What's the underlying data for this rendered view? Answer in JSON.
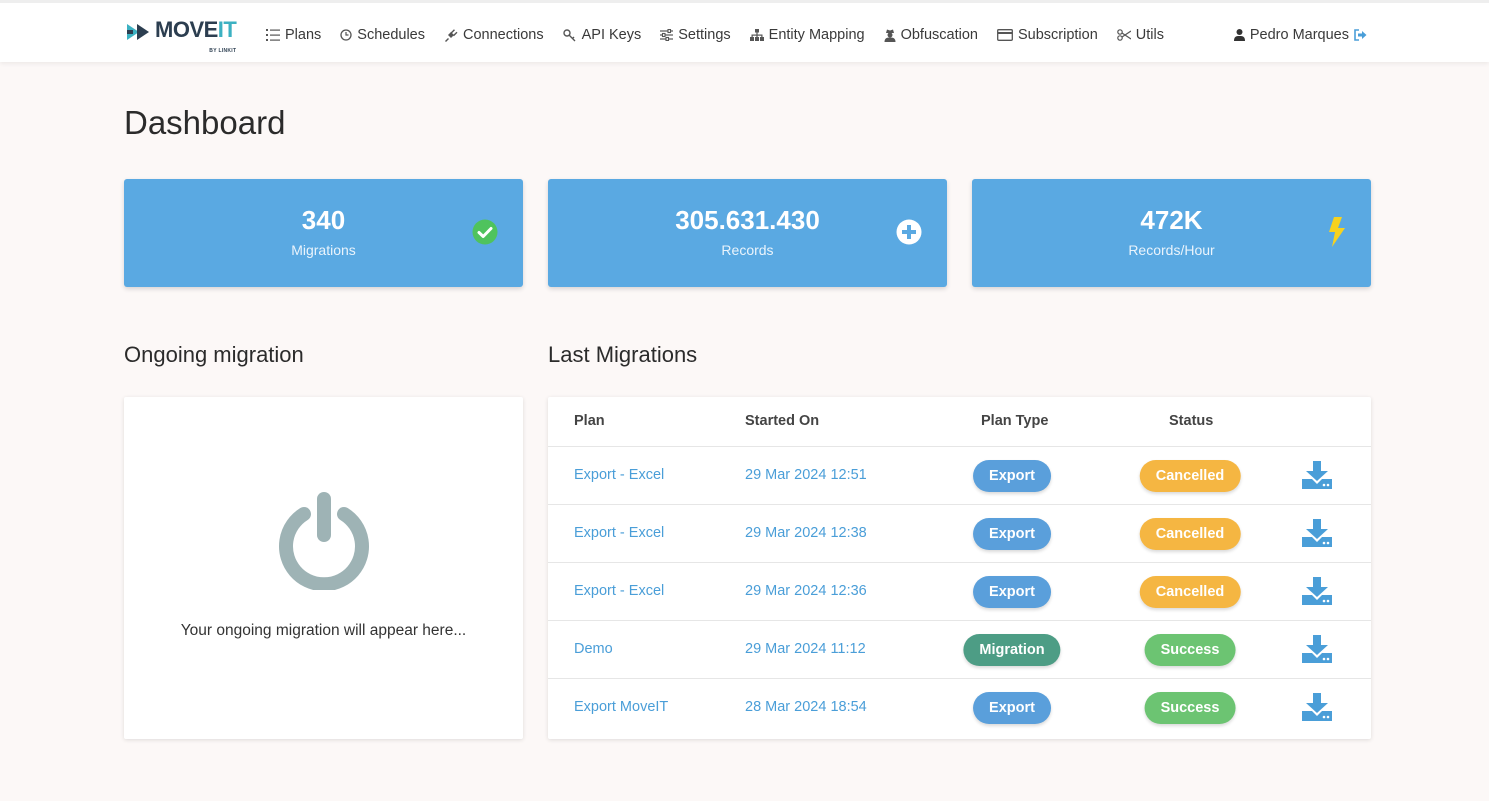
{
  "nav": {
    "logo_main": "MOVE",
    "logo_accent": "IT",
    "logo_sub": "BY LINKIT",
    "items": [
      {
        "label": "Plans",
        "icon": "list-icon"
      },
      {
        "label": "Schedules",
        "icon": "clock-icon"
      },
      {
        "label": "Connections",
        "icon": "plug-icon"
      },
      {
        "label": "API Keys",
        "icon": "key-icon"
      },
      {
        "label": "Settings",
        "icon": "sliders-icon"
      },
      {
        "label": "Entity Mapping",
        "icon": "sitemap-icon"
      },
      {
        "label": "Obfuscation",
        "icon": "user-secret-icon"
      },
      {
        "label": "Subscription",
        "icon": "credit-card-icon"
      },
      {
        "label": "Utils",
        "icon": "scissors-icon"
      }
    ],
    "user_name": "Pedro Marques"
  },
  "page": {
    "title": "Dashboard"
  },
  "stats": [
    {
      "value": "340",
      "label": "Migrations",
      "icon": "check-circle-icon",
      "icon_color": "#4fc35d"
    },
    {
      "value": "305.631.430",
      "label": "Records",
      "icon": "plus-circle-icon",
      "icon_color": "#ffffff"
    },
    {
      "value": "472K",
      "label": "Records/Hour",
      "icon": "bolt-icon",
      "icon_color": "#f6d21f"
    }
  ],
  "ongoing": {
    "title": "Ongoing migration",
    "empty_text": "Your ongoing migration will appear here...",
    "icon": "power-icon"
  },
  "last_migrations": {
    "title": "Last Migrations",
    "columns": [
      "Plan",
      "Started On",
      "Plan Type",
      "Status"
    ],
    "rows": [
      {
        "plan": "Export - Excel",
        "started": "29 Mar 2024 12:51",
        "type": "Export",
        "status": "Cancelled"
      },
      {
        "plan": "Export - Excel",
        "started": "29 Mar 2024 12:38",
        "type": "Export",
        "status": "Cancelled"
      },
      {
        "plan": "Export - Excel",
        "started": "29 Mar 2024 12:36",
        "type": "Export",
        "status": "Cancelled"
      },
      {
        "plan": "Demo",
        "started": "29 Mar 2024 11:12",
        "type": "Migration",
        "status": "Success"
      },
      {
        "plan": "Export MoveIT",
        "started": "28 Mar 2024 18:54",
        "type": "Export",
        "status": "Success"
      }
    ]
  },
  "colors": {
    "card_blue": "#5aa9e2",
    "link_blue": "#4a9ed8",
    "export_badge": "#5a9fdb",
    "migration_badge": "#4d9d85",
    "cancelled_badge": "#f5b642",
    "success_badge": "#6cc472"
  }
}
